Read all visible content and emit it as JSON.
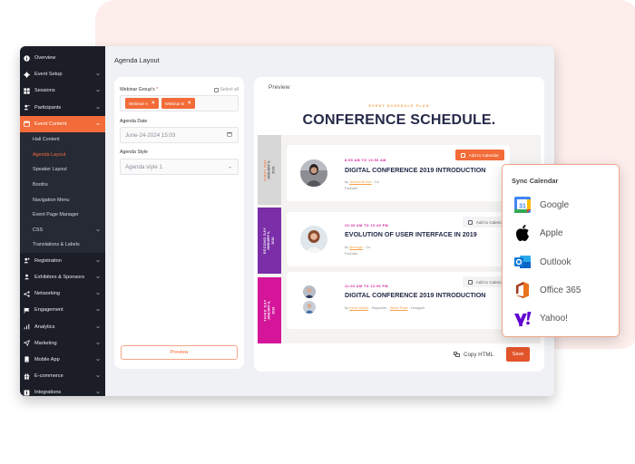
{
  "sidebar": {
    "items": [
      {
        "label": "Overview",
        "icon": "info-icon",
        "chevron": false
      },
      {
        "label": "Event Setup",
        "icon": "gear-icon",
        "chevron": true
      },
      {
        "label": "Sessions",
        "icon": "grid-icon",
        "chevron": true
      },
      {
        "label": "Participants",
        "icon": "users-icon",
        "chevron": true
      },
      {
        "label": "Event Content",
        "icon": "calendar-icon",
        "chevron": true,
        "active": true
      }
    ],
    "sub_items": [
      {
        "label": "Hall Content"
      },
      {
        "label": "Agenda Layout",
        "current": true
      },
      {
        "label": "Speaker Layout"
      },
      {
        "label": "Booths"
      },
      {
        "label": "Navigation Menu"
      },
      {
        "label": "Event Page Manager"
      },
      {
        "label": "CSS",
        "chevron": true
      },
      {
        "label": "Translations & Labels"
      }
    ],
    "items_after": [
      {
        "label": "Registration",
        "icon": "user-plus-icon"
      },
      {
        "label": "Exhibitors & Sponsors",
        "icon": "user-icon"
      },
      {
        "label": "Networking",
        "icon": "share-icon"
      },
      {
        "label": "Engagement",
        "icon": "flag-icon"
      },
      {
        "label": "Analytics",
        "icon": "bar-chart-icon"
      },
      {
        "label": "Marketing",
        "icon": "send-icon"
      },
      {
        "label": "Mobile App",
        "icon": "mobile-icon"
      },
      {
        "label": "E-commerce",
        "icon": "gift-icon"
      },
      {
        "label": "Integrations",
        "icon": "plug-icon"
      }
    ]
  },
  "page": {
    "title": "Agenda Layout"
  },
  "form": {
    "webinar_groups_label": "Webinar Group's",
    "required_mark": "*",
    "select_all": "Select all",
    "tags": [
      "Webinar A",
      "Webinar B"
    ],
    "agenda_date_label": "Agenda Date",
    "agenda_date_value": "June-24-2024  15:03",
    "agenda_style_label": "Agenda Style",
    "agenda_style_value": "Agenda style 1",
    "preview_button": "Preview"
  },
  "preview": {
    "label": "Preview",
    "eyebrow": "EVENT SCHEDULE PLAN",
    "title": "CONFERENCE SCHEDULE.",
    "days": [
      {
        "label": "FIRST DAY",
        "date": "JANUARY 5,",
        "year": "2019"
      },
      {
        "label": "SECOND DAY",
        "date": "JANUARY 6,",
        "year": "2019"
      },
      {
        "label": "THIRD DAY",
        "date": "JANUARY 8,",
        "year": "2019"
      }
    ],
    "sessions": [
      {
        "time": "8:55 AM TO 10:50 AM",
        "title": "DIGITAL CONFERENCE 2019 INTRODUCTION",
        "by": "by",
        "speaker": "Jessica Brown",
        "role_inline": "- Co",
        "role": "Founder",
        "calendar_button": "Add to Calendar"
      },
      {
        "time": "10:00 AM TO 10:40 PM",
        "title": "EVOLUTION OF USER INTERFACE IN 2019",
        "by": "by",
        "speaker": "Manager",
        "role_inline": "- Co",
        "role": "Founder",
        "calendar_button": "Add to Calendar"
      },
      {
        "time": "11:00 AM TO 12:00 PM",
        "title": "DIGITAL CONFERENCE 2019 INTRODUCTION",
        "by": "by",
        "speaker": "Kevin Martin",
        "role_inline": "- Supporter -",
        "speaker2": "Sarah Rose",
        "role2": "- Designer",
        "calendar_button": "Add to Calendar"
      }
    ],
    "copy_html": "Copy HTML",
    "save": "Save"
  },
  "sync_calendar": {
    "title": "Sync Calendar",
    "options": [
      {
        "label": "Google",
        "icon": "google-calendar-icon"
      },
      {
        "label": "Apple",
        "icon": "apple-icon"
      },
      {
        "label": "Outlook",
        "icon": "outlook-icon"
      },
      {
        "label": "Office 365",
        "icon": "office365-icon"
      },
      {
        "label": "Yahoo!",
        "icon": "yahoo-icon"
      }
    ]
  },
  "colors": {
    "accent": "#f26b38",
    "sidebar_bg": "#1b1e27",
    "day2": "#7b2ea8",
    "day3": "#d4159a",
    "title_navy": "#262a49"
  }
}
